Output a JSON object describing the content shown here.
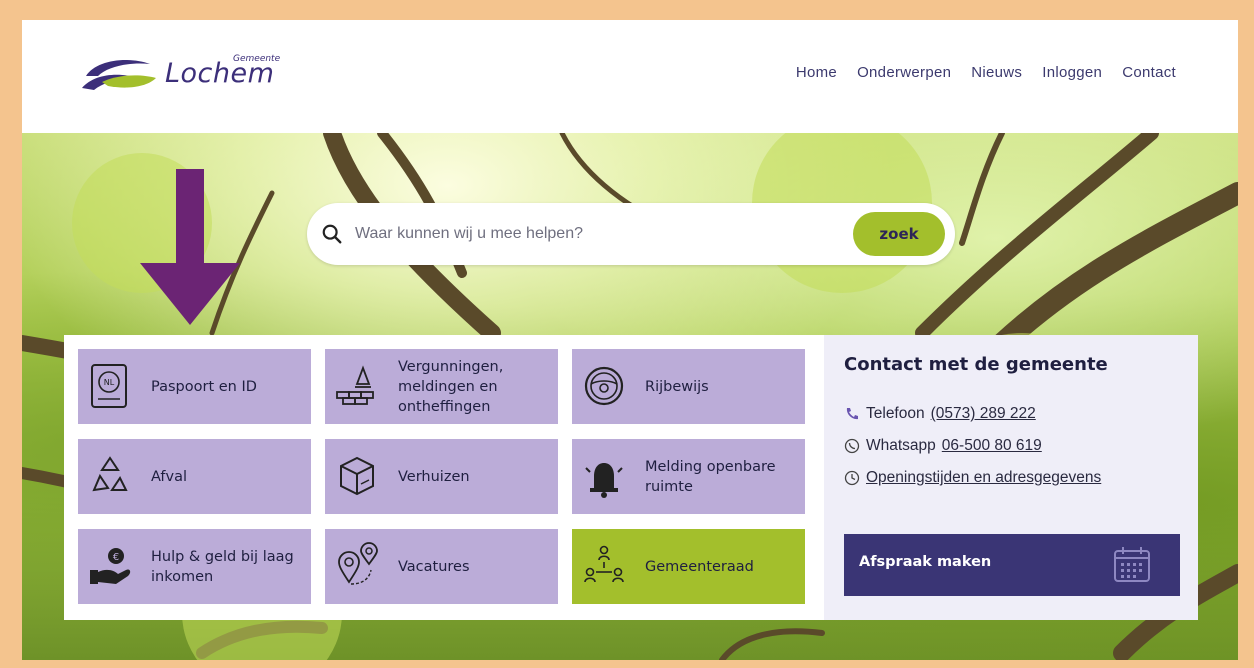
{
  "header": {
    "logo": {
      "name": "Lochem",
      "small": "Gemeente"
    },
    "nav": [
      "Home",
      "Onderwerpen",
      "Nieuws",
      "Inloggen",
      "Contact"
    ]
  },
  "search": {
    "placeholder": "Waar kunnen wij u mee helpen?",
    "button": "zoek",
    "icon": "search-icon"
  },
  "tiles": [
    {
      "label": "Paspoort en ID",
      "icon": "passport-icon"
    },
    {
      "label": "Vergunningen, meldingen en ontheffingen",
      "icon": "construction-icon"
    },
    {
      "label": "Rijbewijs",
      "icon": "steering-wheel-icon"
    },
    {
      "label": "Afval",
      "icon": "recycle-icon"
    },
    {
      "label": "Verhuizen",
      "icon": "moving-box-icon"
    },
    {
      "label": "Melding openbare ruimte",
      "icon": "alarm-bell-icon"
    },
    {
      "label": "Hulp & geld bij laag inkomen",
      "icon": "hand-money-icon"
    },
    {
      "label": "Vacatures",
      "icon": "location-pins-icon"
    },
    {
      "label": "Gemeenteraad",
      "icon": "council-icon"
    }
  ],
  "contact": {
    "title": "Contact met de gemeente",
    "phone_label": "Telefoon",
    "phone": "(0573) 289 222",
    "whatsapp_label": "Whatsapp",
    "whatsapp": "06-500 80 619",
    "hours": "Openingstijden en adresgegevens",
    "appointment": "Afspraak maken"
  },
  "colors": {
    "tile": "#bbacd8",
    "tile_highlight": "#a3bf2c",
    "accent_purple": "#3a3575",
    "frame": "#f4c48e",
    "arrow": "#6b2474"
  }
}
